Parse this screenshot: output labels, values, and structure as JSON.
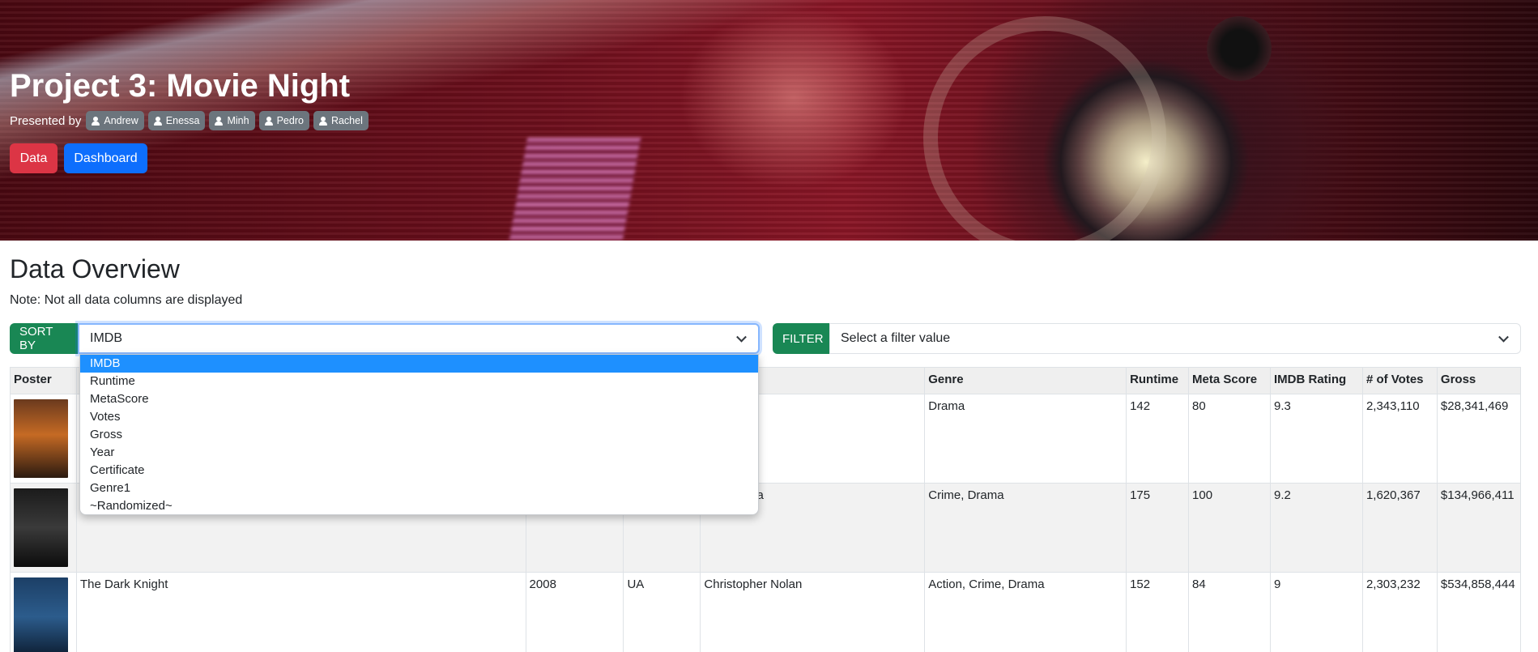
{
  "hero": {
    "title": "Project 3: Movie Night",
    "presented_by": "Presented by",
    "presenters": [
      "Andrew",
      "Enessa",
      "Minh",
      "Pedro",
      "Rachel"
    ],
    "buttons": {
      "data": "Data",
      "dashboard": "Dashboard"
    }
  },
  "overview": {
    "title": "Data Overview",
    "note": "Note: Not all data columns are displayed"
  },
  "sort": {
    "label": "SORT BY",
    "value": "IMDB",
    "options": [
      "IMDB",
      "Runtime",
      "MetaScore",
      "Votes",
      "Gross",
      "Year",
      "Certificate",
      "Genre1",
      "~Randomized~"
    ]
  },
  "filter": {
    "label": "FILTER",
    "placeholder": "Select a filter value"
  },
  "table": {
    "headers": [
      "Poster",
      "",
      "",
      "",
      "",
      "Genre",
      "Runtime",
      "Meta Score",
      "IMDB Rating",
      "# of Votes",
      "Gross"
    ],
    "rows": [
      {
        "title": "",
        "year": "",
        "cert": "",
        "director": "abont",
        "genre": "Drama",
        "runtime": "142",
        "meta": "80",
        "imdb": "9.3",
        "votes": "2,343,110",
        "gross": "$28,341,469"
      },
      {
        "title": "",
        "year": "",
        "cert": "",
        "director": "rd Coppola",
        "genre": "Crime, Drama",
        "runtime": "175",
        "meta": "100",
        "imdb": "9.2",
        "votes": "1,620,367",
        "gross": "$134,966,411"
      },
      {
        "title": "The Dark Knight",
        "year": "2008",
        "cert": "UA",
        "director": "Christopher Nolan",
        "genre": "Action, Crime, Drama",
        "runtime": "152",
        "meta": "84",
        "imdb": "9",
        "votes": "2,303,232",
        "gross": "$534,858,444"
      }
    ]
  },
  "colors": {
    "data_button": "#dc3545",
    "dashboard_button": "#0d6efd",
    "group_label": "#198754",
    "badge": "#6c757d",
    "dropdown_selected": "#1e90ff"
  }
}
